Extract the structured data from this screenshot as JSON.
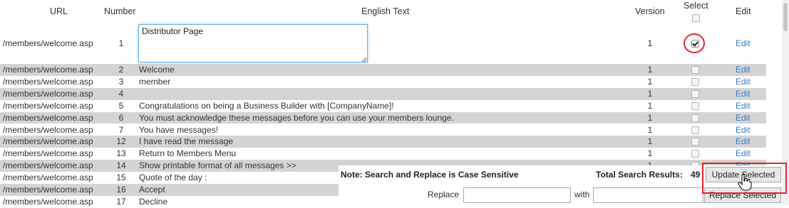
{
  "headers": {
    "url": "URL",
    "number": "Number",
    "english_text": "English Text",
    "version": "Version",
    "select": "Select",
    "edit": "Edit"
  },
  "first_row": {
    "url": "/members/welcome.asp",
    "number": "1",
    "text": "Distributor Page",
    "version": "1",
    "selected": true,
    "edit": "Edit"
  },
  "rows": [
    {
      "url": "/members/welcome.asp",
      "number": "2",
      "text": "Welcome",
      "version": "1",
      "edit": "Edit"
    },
    {
      "url": "/members/welcome.asp",
      "number": "3",
      "text": "member",
      "version": "1",
      "edit": "Edit"
    },
    {
      "url": "/members/welcome.asp",
      "number": "4",
      "text": "",
      "version": "1",
      "edit": "Edit"
    },
    {
      "url": "/members/welcome.asp",
      "number": "5",
      "text": "Congratulations on being a Business Builder with [CompanyName]!",
      "version": "1",
      "edit": "Edit"
    },
    {
      "url": "/members/welcome.asp",
      "number": "6",
      "text": "You must acknowledge these messages before you can use your members lounge.",
      "version": "1",
      "edit": "Edit"
    },
    {
      "url": "/members/welcome.asp",
      "number": "7",
      "text": "You have messages!",
      "version": "1",
      "edit": "Edit"
    },
    {
      "url": "/members/welcome.asp",
      "number": "12",
      "text": "I have read the message",
      "version": "1",
      "edit": "Edit"
    },
    {
      "url": "/members/welcome.asp",
      "number": "13",
      "text": "Return to Members Menu",
      "version": "1",
      "edit": "Edit"
    },
    {
      "url": "/members/welcome.asp",
      "number": "14",
      "text": "Show printable format of all messages >>",
      "version": "1",
      "edit": "Edit"
    },
    {
      "url": "/members/welcome.asp",
      "number": "15",
      "text": "Quote of the day :",
      "version": "",
      "edit": ""
    },
    {
      "url": "/members/welcome.asp",
      "number": "16",
      "text": "Accept",
      "version": "",
      "edit": ""
    },
    {
      "url": "/members/welcome.asp",
      "number": "17",
      "text": "Decline",
      "version": "",
      "edit": ""
    }
  ],
  "search_panel": {
    "note": "Note: Search and Replace is Case Sensitive",
    "total_label": "Total Search Results:",
    "total_count": "49",
    "update_button": "Update Selected",
    "replace_label": "Replace",
    "replace_value": "",
    "with_label": "with",
    "with_value": "",
    "replace_button": "Replace Selected"
  },
  "colors": {
    "link": "#3b7bc3",
    "row_alt": "#d4d4d4",
    "highlight": "#e32626"
  }
}
